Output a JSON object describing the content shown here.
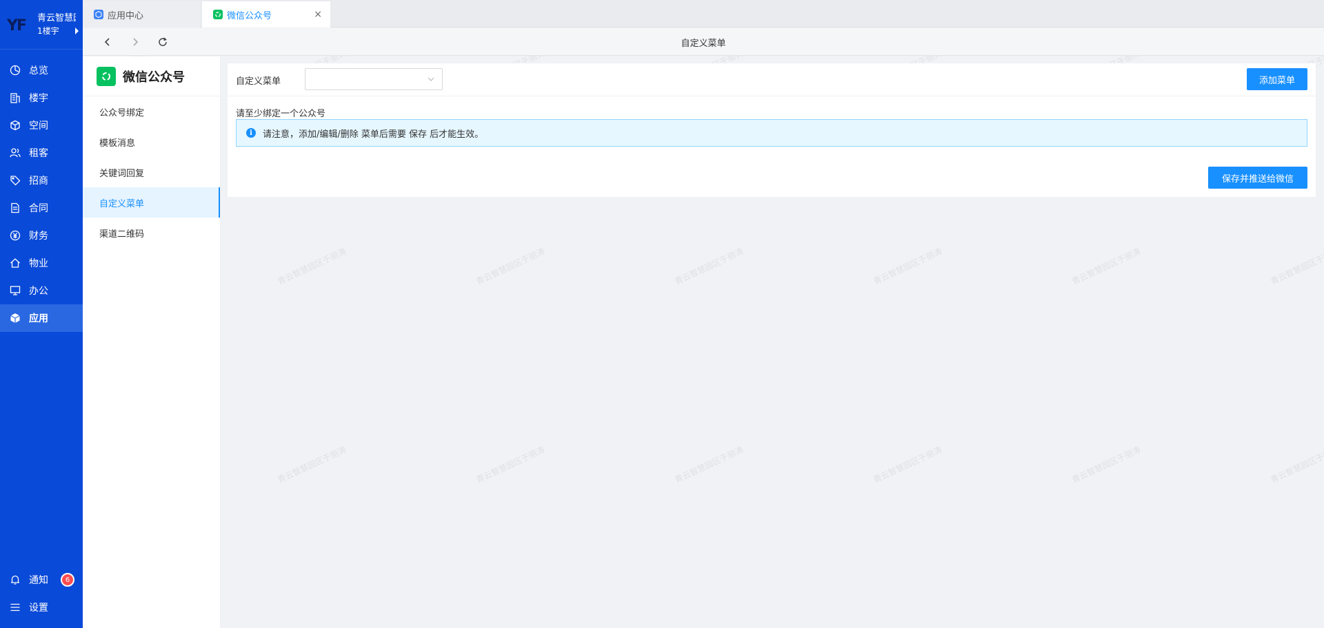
{
  "brand": {
    "name": "青云智慧园区",
    "sub": "1楼宇"
  },
  "nav": {
    "items": [
      {
        "label": "总览",
        "icon": "dashboard-icon"
      },
      {
        "label": "楼宇",
        "icon": "building-icon"
      },
      {
        "label": "空间",
        "icon": "cube-icon"
      },
      {
        "label": "租客",
        "icon": "users-icon"
      },
      {
        "label": "招商",
        "icon": "tag-icon"
      },
      {
        "label": "合同",
        "icon": "document-icon"
      },
      {
        "label": "财务",
        "icon": "yen-icon"
      },
      {
        "label": "物业",
        "icon": "home-icon"
      },
      {
        "label": "办公",
        "icon": "monitor-icon"
      },
      {
        "label": "应用",
        "icon": "app-cube-icon",
        "active": true
      }
    ],
    "bottom": [
      {
        "label": "通知",
        "icon": "bell-icon",
        "badge": "6"
      },
      {
        "label": "设置",
        "icon": "menu-icon"
      }
    ]
  },
  "tabs": [
    {
      "label": "应用中心",
      "icon": "app-center-icon"
    },
    {
      "label": "微信公众号",
      "icon": "wechat-icon",
      "active": true,
      "close": "×"
    }
  ],
  "toolbar": {
    "title": "自定义菜单"
  },
  "subnav": {
    "title": "微信公众号",
    "items": [
      {
        "label": "公众号绑定"
      },
      {
        "label": "模板消息"
      },
      {
        "label": "关键词回复"
      },
      {
        "label": "自定义菜单",
        "active": true
      },
      {
        "label": "渠道二维码"
      }
    ]
  },
  "main": {
    "menu_label": "自定义菜单",
    "select_value": "",
    "add_button": "添加菜单",
    "warning": "请至少绑定一个公众号",
    "alert": "请注意，添加/编辑/删除 菜单后需要 保存 后才能生效。",
    "save_button": "保存并推送给微信"
  },
  "watermark": "青云智慧园区于丽涛",
  "colors": {
    "rail": "#0a4ad8",
    "primary": "#1890ff",
    "wechat": "#07c160",
    "badge": "#ff4d4f"
  }
}
